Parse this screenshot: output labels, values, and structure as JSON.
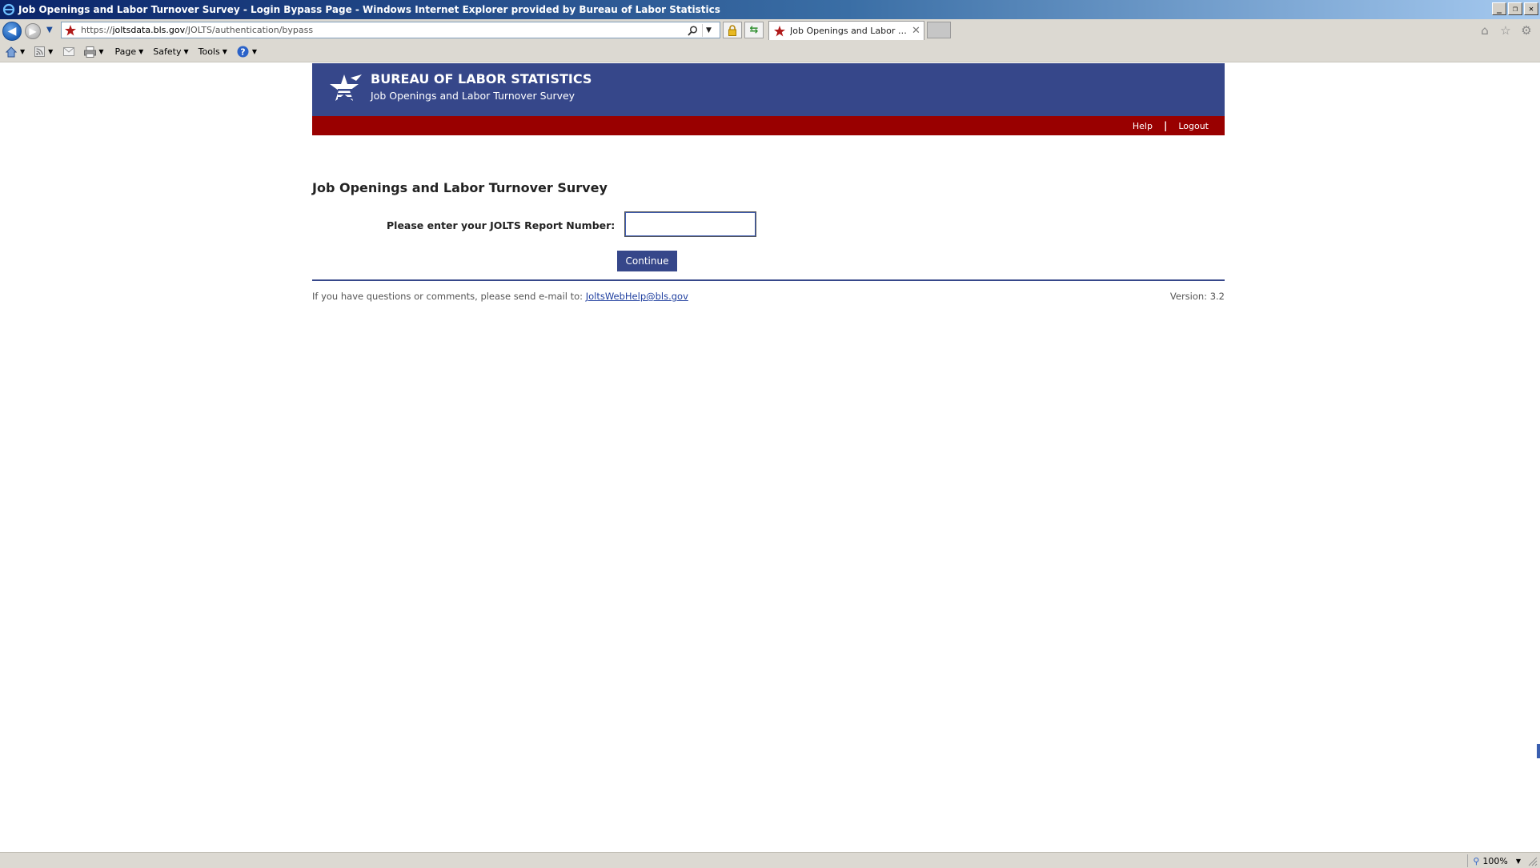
{
  "window": {
    "title": "Job Openings and Labor Turnover Survey - Login Bypass Page - Windows Internet Explorer provided by Bureau of Labor Statistics",
    "controls": {
      "minimize": "_",
      "restore": "❐",
      "close": "✕"
    }
  },
  "address_bar": {
    "url_prefix": "https://",
    "url_domain": "joltsdata.bls.gov",
    "url_path": "/JOLTS/authentication/bypass"
  },
  "tab": {
    "label": "Job Openings and Labor Tur...",
    "close": "✕"
  },
  "command_bar": {
    "page": "Page",
    "safety": "Safety",
    "tools": "Tools"
  },
  "header": {
    "agency": "BUREAU OF LABOR STATISTICS",
    "survey": "Job Openings and Labor Turnover Survey",
    "nav": {
      "help": "Help",
      "separator": "|",
      "logout": "Logout"
    }
  },
  "main": {
    "heading": "Job Openings and Labor Turnover Survey",
    "report_label": "Please enter your JOLTS Report Number:",
    "report_value": "",
    "continue_label": "Continue"
  },
  "footer": {
    "note": "If you have questions or comments, please send e-mail to:",
    "email": "JoltsWebHelp@bls.gov",
    "version": "Version: 3.2"
  },
  "status_bar": {
    "zoom": "100%"
  },
  "colors": {
    "banner": "#36478a",
    "redbar": "#990000",
    "button": "#36478a"
  }
}
